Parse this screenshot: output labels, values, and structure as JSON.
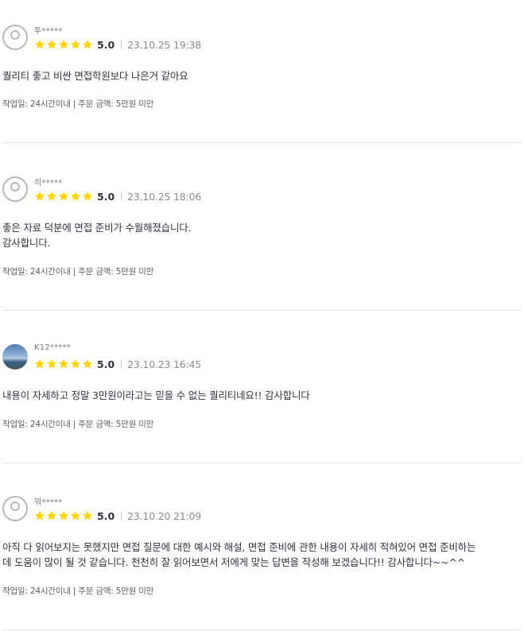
{
  "colors": {
    "star": "#ffd400",
    "divider": "#e4e5e7",
    "text": "#303441",
    "muted": "#8a8d94"
  },
  "reviews": [
    {
      "nickname": "투*****",
      "avatar": "default-avatar-icon",
      "stars": 5,
      "score": "5.0",
      "date": "23.10.25 19:38",
      "body": "퀄리티 좋고 비싼 면접학원보다 나은거 같아요",
      "meta": "작업일: 24시간이내 | 주문 금액: 5만원 미만"
    },
    {
      "nickname": "히*****",
      "avatar": "default-avatar-icon",
      "stars": 5,
      "score": "5.0",
      "date": "23.10.25 18:06",
      "body": "좋은 자료 덕분에 면접 준비가 수월해졌습니다.\n감사합니다.",
      "meta": "작업일: 24시간이내 | 주문 금액: 5만원 미만"
    },
    {
      "nickname": "K12*****",
      "avatar": "photo-avatar",
      "stars": 5,
      "score": "5.0",
      "date": "23.10.23 16:45",
      "body": "내용이 자세하고 정말 3만원이라고는 믿을 수 없는 퀄리티네요!! 감사합니다",
      "meta": "작업일: 24시간이내 | 주문 금액: 5만원 미만"
    },
    {
      "nickname": "뭐*****",
      "avatar": "default-avatar-icon",
      "stars": 5,
      "score": "5.0",
      "date": "23.10.20 21:09",
      "body": "아직 다 읽어보지는 못했지만 면접 질문에 대한 예시와 해설, 면접 준비에 관한 내용이 자세히 적혀있어 면접 준비하는\n데 도움이 많이 될 것 같습니다. 천천히 잘 읽어보면서 저에게 맞는 답변을 작성해 보겠습니다!! 감사합니다~~^^",
      "meta": "작업일: 24시간이내 | 주문 금액: 5만원 미만"
    }
  ]
}
